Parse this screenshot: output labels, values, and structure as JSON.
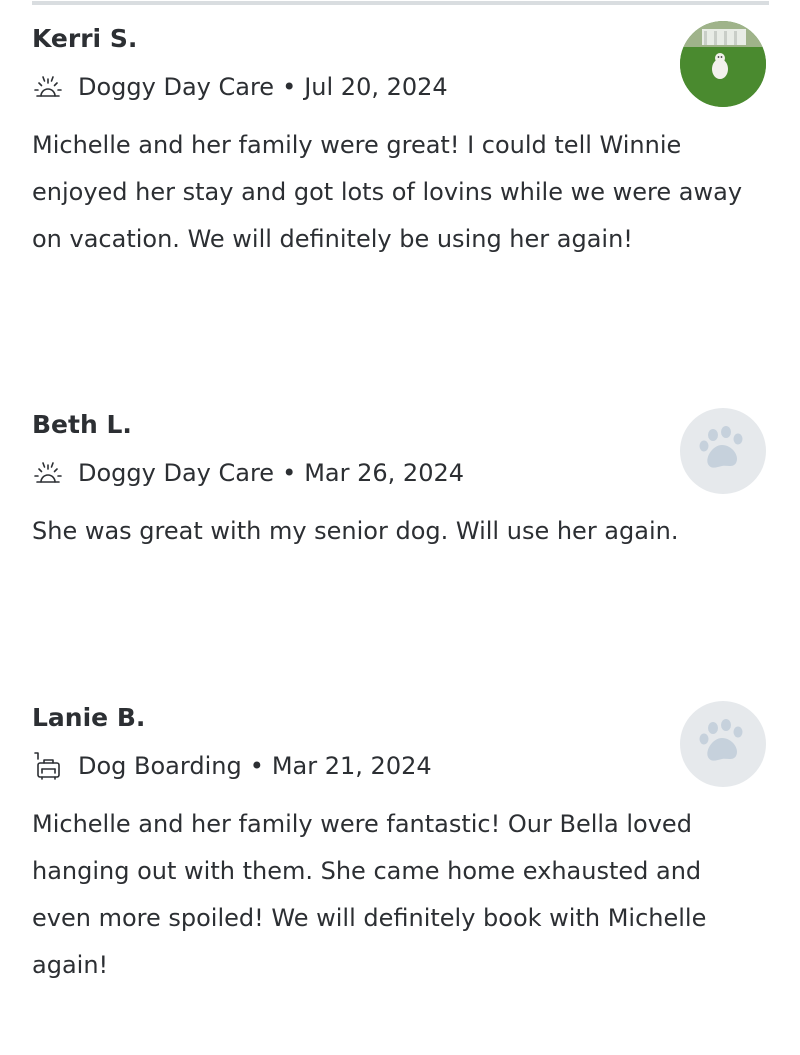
{
  "reviews": [
    {
      "name": "Kerri S.",
      "service_icon": "sunrise-icon",
      "service": "Doggy Day Care",
      "separator": "•",
      "date": "Jul 20, 2024",
      "avatar": "dog-photo",
      "text": "Michelle and her family were great! I could tell Winnie enjoyed her stay and got lots of lovins while we were away on vacation. We will definitely be using her again!"
    },
    {
      "name": "Beth L.",
      "service_icon": "sunrise-icon",
      "service": "Doggy Day Care",
      "separator": "•",
      "date": "Mar 26, 2024",
      "avatar": "paw-icon",
      "text": "She was great with my senior dog. Will use her again."
    },
    {
      "name": "Lanie B.",
      "service_icon": "suitcase-icon",
      "service": "Dog Boarding",
      "separator": "•",
      "date": "Mar 21, 2024",
      "avatar": "paw-icon",
      "text": "Michelle and her family were fantastic! Our Bella loved hanging out with them. She came home exhausted and even more spoiled! We will definitely book with Michelle again!"
    }
  ]
}
